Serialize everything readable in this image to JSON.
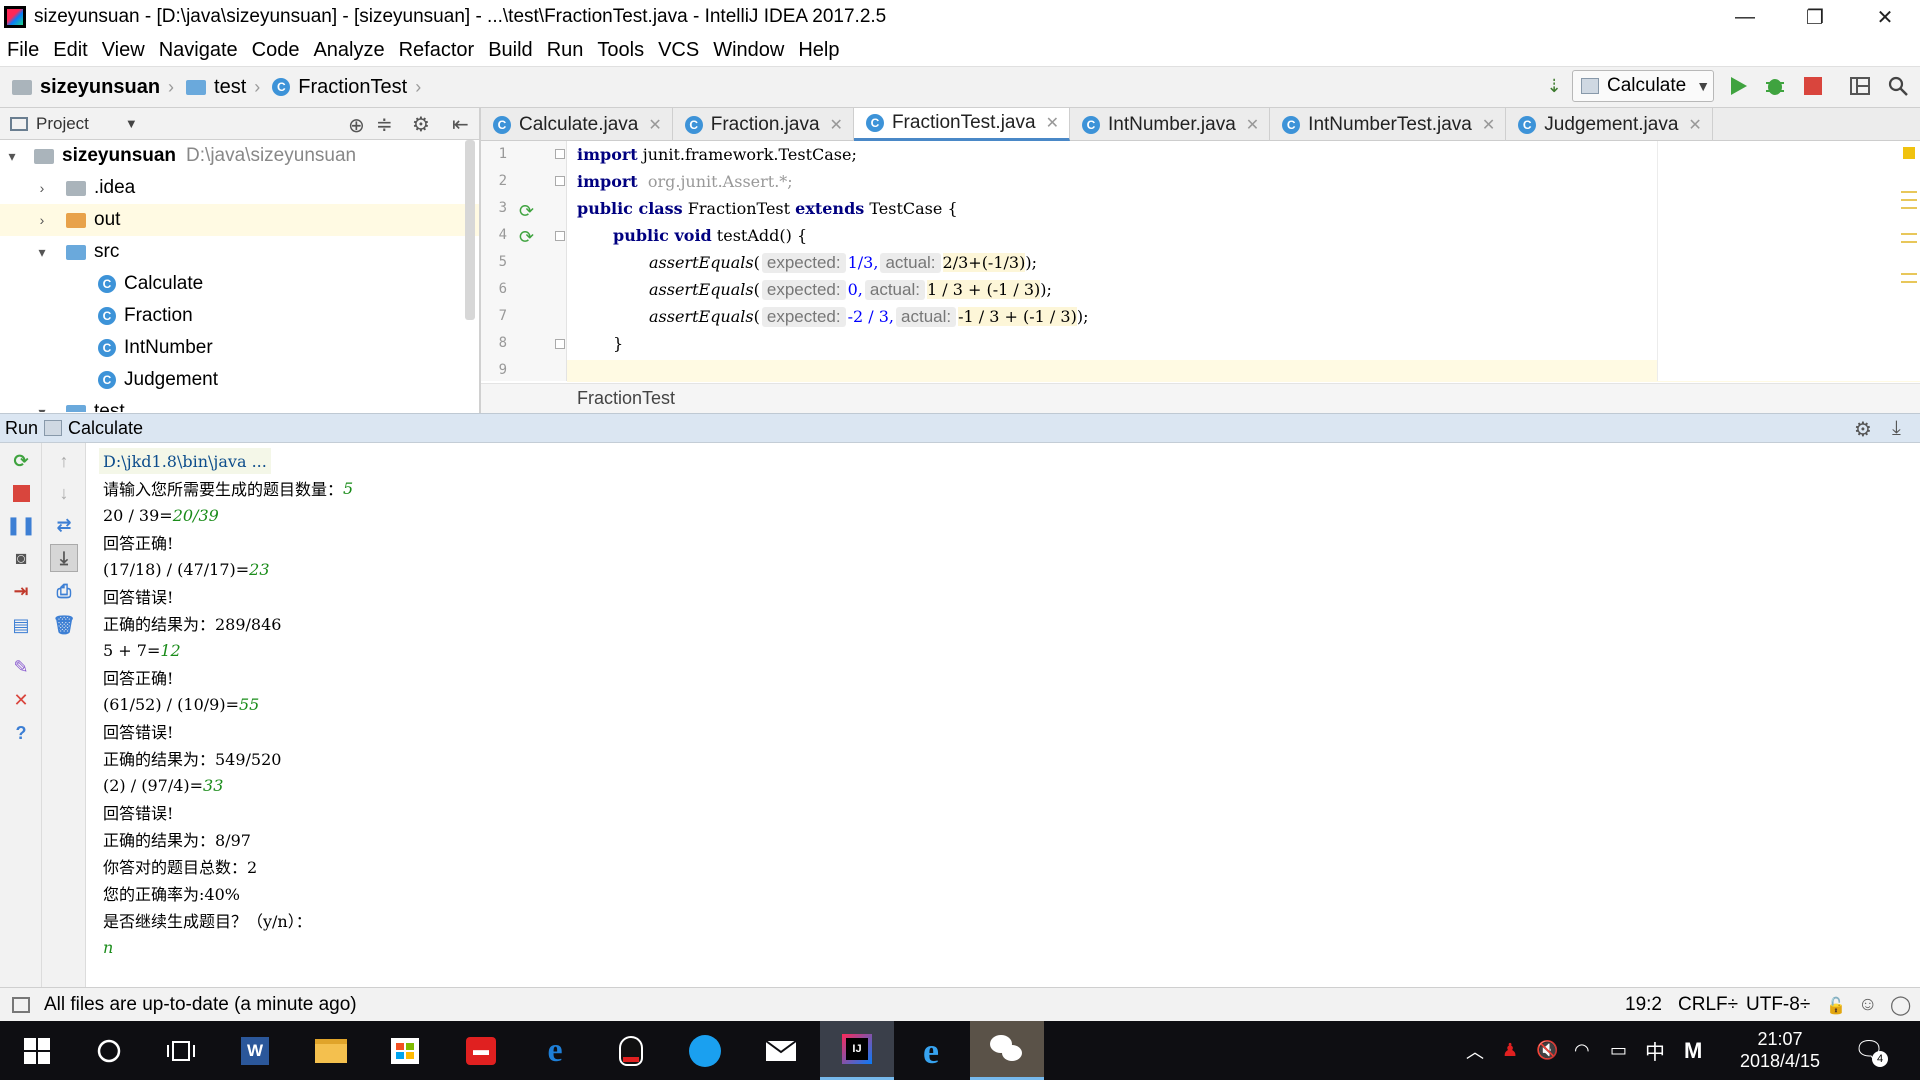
{
  "window": {
    "title": "sizeyunsuan - [D:\\java\\sizeyunsuan] - [sizeyunsuan] - ...\\test\\FractionTest.java - IntelliJ IDEA 2017.2.5",
    "minimize": "—",
    "restore": "❐",
    "close": "✕"
  },
  "menu": [
    "File",
    "Edit",
    "View",
    "Navigate",
    "Code",
    "Analyze",
    "Refactor",
    "Build",
    "Run",
    "Tools",
    "VCS",
    "Window",
    "Help"
  ],
  "breadcrumb": [
    "sizeyunsuan",
    "test",
    "FractionTest"
  ],
  "toolbar": {
    "run_config": "Calculate"
  },
  "project_panel": {
    "header": "Project",
    "root_name": "sizeyunsuan",
    "root_path": "D:\\java\\sizeyunsuan",
    "items": [
      {
        "label": ".idea",
        "type": "folder"
      },
      {
        "label": "out",
        "type": "folder"
      },
      {
        "label": "src",
        "type": "folder"
      },
      {
        "label": "Calculate",
        "type": "class"
      },
      {
        "label": "Fraction",
        "type": "class"
      },
      {
        "label": "IntNumber",
        "type": "class"
      },
      {
        "label": "Judgement",
        "type": "class"
      },
      {
        "label": "test",
        "type": "folder"
      }
    ]
  },
  "editor_tabs": [
    "Calculate.java",
    "Fraction.java",
    "FractionTest.java",
    "IntNumber.java",
    "IntNumberTest.java",
    "Judgement.java"
  ],
  "active_tab": "FractionTest.java",
  "code": {
    "line_numbers": [
      "1",
      "2",
      "3",
      "4",
      "5",
      "6",
      "7",
      "8",
      "9"
    ],
    "l1_kw": "import",
    "l1_rest": " junit.framework.TestCase;",
    "l2_kw": "import",
    "l2_rest": "  org.junit.Assert.*;",
    "l3_kw1": "public class",
    "l3_mid": " FractionTest ",
    "l3_kw2": "extends",
    "l3_rest": " TestCase {",
    "l4_kw": "public void",
    "l4_rest": " testAdd() {",
    "assert_fn": "assertEquals",
    "hint_expected": "expected:",
    "hint_actual": "actual:",
    "l5_exp": "1/3,",
    "l5_act": "2/3+(-1/3)",
    "l6_exp": "0,",
    "l6_act": "1 / 3 + (-1 / 3)",
    "l7_exp": "-2 / 3,",
    "l7_act": "-1 / 3 + (-1 / 3)",
    "l8": "}",
    "open_paren": "(",
    "close": ");"
  },
  "editor_breadcrumb": "FractionTest",
  "run_panel": {
    "label": "Run",
    "config": "Calculate"
  },
  "console": [
    {
      "text": "D:\\jkd1.8\\bin\\java ...",
      "input": ""
    },
    {
      "text": "请输入您所需要生成的题目数量：",
      "input": "5"
    },
    {
      "text": "20 / 39=",
      "input": "20/39"
    },
    {
      "text": "回答正确!",
      "input": ""
    },
    {
      "text": "(17/18) / (47/17)=",
      "input": "23"
    },
    {
      "text": "回答错误!",
      "input": ""
    },
    {
      "text": "正确的结果为：289/846",
      "input": ""
    },
    {
      "text": "5 + 7=",
      "input": "12"
    },
    {
      "text": "回答正确!",
      "input": ""
    },
    {
      "text": "(61/52) / (10/9)=",
      "input": "55"
    },
    {
      "text": "回答错误!",
      "input": ""
    },
    {
      "text": "正确的结果为：549/520",
      "input": ""
    },
    {
      "text": "(2) / (97/4)=",
      "input": "33"
    },
    {
      "text": "回答错误!",
      "input": ""
    },
    {
      "text": "正确的结果为：8/97",
      "input": ""
    },
    {
      "text": "你答对的题目总数：2",
      "input": ""
    },
    {
      "text": "您的正确率为:40%",
      "input": ""
    },
    {
      "text": "是否继续生成题目？（y/n）：",
      "input": ""
    },
    {
      "text": "",
      "input": "n"
    }
  ],
  "status": {
    "message": "All files are up-to-date (a minute ago)",
    "position": "19:2",
    "line_sep": "CRLF÷",
    "encoding": "UTF-8÷"
  },
  "taskbar": {
    "time": "21:07",
    "date": "2018/4/15",
    "ime": "中",
    "notif_count": "4"
  },
  "colors": {
    "accent": "#4a88c7",
    "run_green": "#3fa33f",
    "stop_red": "#d9453d",
    "input_green": "#1a8c1a"
  }
}
